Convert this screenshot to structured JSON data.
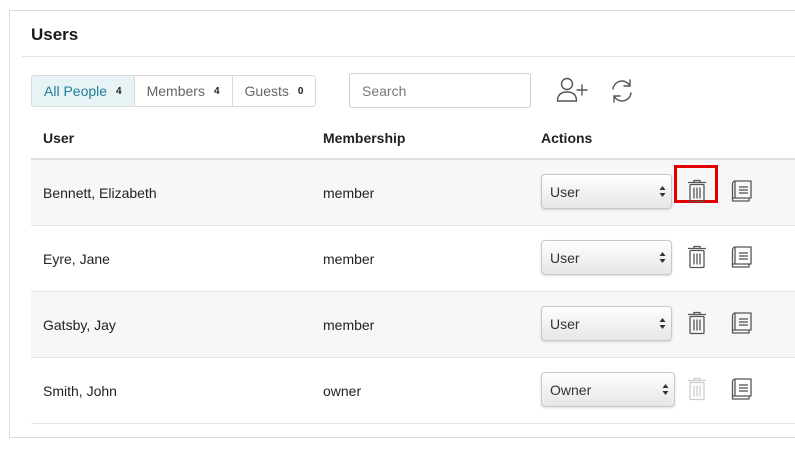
{
  "panel": {
    "title": "Users"
  },
  "tabs": [
    {
      "label": "All People",
      "count": "4",
      "active": true
    },
    {
      "label": "Members",
      "count": "4",
      "active": false
    },
    {
      "label": "Guests",
      "count": "0",
      "active": false
    }
  ],
  "search": {
    "placeholder": "Search",
    "value": ""
  },
  "toolbar": {
    "add_user_icon": "add-user-icon",
    "refresh_icon": "refresh-icon"
  },
  "table": {
    "columns": [
      "User",
      "Membership",
      "Actions"
    ],
    "rows": [
      {
        "user": "Bennett, Elizabeth",
        "membership": "member",
        "role": "User",
        "delete_enabled": true,
        "delete_highlighted": true
      },
      {
        "user": "Eyre, Jane",
        "membership": "member",
        "role": "User",
        "delete_enabled": true,
        "delete_highlighted": false
      },
      {
        "user": "Gatsby, Jay",
        "membership": "member",
        "role": "User",
        "delete_enabled": true,
        "delete_highlighted": false
      },
      {
        "user": "Smith, John",
        "membership": "owner",
        "role": "Owner",
        "delete_enabled": false,
        "delete_highlighted": false
      }
    ]
  },
  "colors": {
    "accent": "#1e7d99",
    "active_tab_bg": "#e8f3f6",
    "highlight": "#e00000",
    "icon": "#555555",
    "icon_disabled": "#cccccc"
  }
}
